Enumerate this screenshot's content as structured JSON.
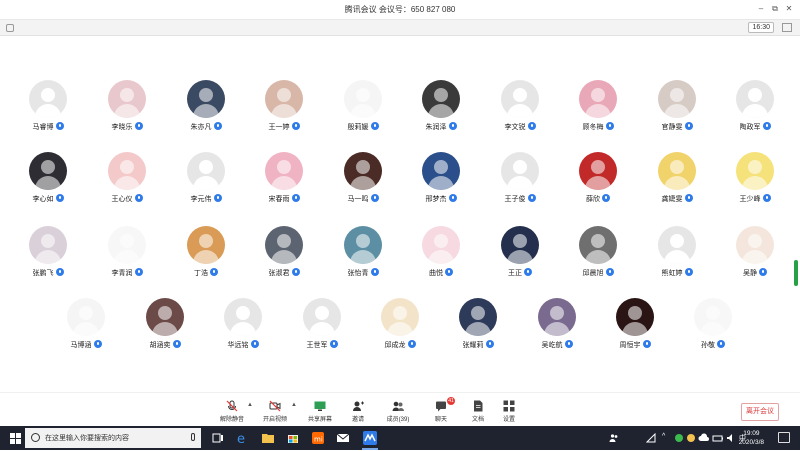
{
  "window": {
    "title": "腾讯会议  会议号：650 827 080",
    "controls": [
      "–",
      "⧉",
      "✕"
    ]
  },
  "subbar": {
    "timer": "16:30"
  },
  "participants": [
    {
      "name": "马睿博",
      "pic": false
    },
    {
      "name": "李晓乐",
      "pic": true,
      "color": "#e8c8cc"
    },
    {
      "name": "朱亦凡",
      "pic": true,
      "color": "#3b4a63"
    },
    {
      "name": "王一婷",
      "pic": true,
      "color": "#d8b7a8"
    },
    {
      "name": "殷莉媛",
      "pic": true,
      "color": "#f5f5f5"
    },
    {
      "name": "朱润泽",
      "pic": true,
      "color": "#3a3a3a"
    },
    {
      "name": "李文锐",
      "pic": false
    },
    {
      "name": "顾冬梅",
      "pic": true,
      "color": "#e9a8b8"
    },
    {
      "name": "官静雯",
      "pic": true,
      "color": "#d7cbc5"
    },
    {
      "name": "陶政军",
      "pic": false
    },
    {
      "name": "李心如",
      "pic": true,
      "color": "#2e2d33"
    },
    {
      "name": "王心仪",
      "pic": true,
      "color": "#f3c9c9"
    },
    {
      "name": "李元伟",
      "pic": false
    },
    {
      "name": "宋春雨",
      "pic": true,
      "color": "#f0b3c4"
    },
    {
      "name": "马一鸣",
      "pic": true,
      "color": "#4a2b25"
    },
    {
      "name": "邢梦杰",
      "pic": true,
      "color": "#2a4f8a"
    },
    {
      "name": "王子俊",
      "pic": false
    },
    {
      "name": "薛欣",
      "pic": true,
      "color": "#c22a2a"
    },
    {
      "name": "龚婕雯",
      "pic": true,
      "color": "#f1d36b"
    },
    {
      "name": "王少峰",
      "pic": true,
      "color": "#f6e27a"
    },
    {
      "name": "张鹏飞",
      "pic": true,
      "color": "#d9d0d9"
    },
    {
      "name": "李青润",
      "pic": true,
      "color": "#f7f7f7"
    },
    {
      "name": "丁浩",
      "pic": true,
      "color": "#d99b55"
    },
    {
      "name": "张淑君",
      "pic": true,
      "color": "#5b6470"
    },
    {
      "name": "张怡青",
      "pic": true,
      "color": "#5c8fa3"
    },
    {
      "name": "曲悦",
      "pic": true,
      "color": "#f6d9e1"
    },
    {
      "name": "王正",
      "pic": true,
      "color": "#232f4d"
    },
    {
      "name": "邱晨旭",
      "pic": true,
      "color": "#6f6f6f"
    },
    {
      "name": "熊虹婷",
      "pic": false
    },
    {
      "name": "吴静",
      "pic": true,
      "color": "#f4e6dc"
    },
    {
      "name": "马博涵",
      "pic": true,
      "color": "#f5f5f5"
    },
    {
      "name": "胡涵奕",
      "pic": true,
      "color": "#6b4a48"
    },
    {
      "name": "华远铭",
      "pic": false
    },
    {
      "name": "王世军",
      "pic": false
    },
    {
      "name": "邱成龙",
      "pic": true,
      "color": "#f3e4c9"
    },
    {
      "name": "张耀莉",
      "pic": true,
      "color": "#2d3a5a"
    },
    {
      "name": "吴屹航",
      "pic": true,
      "color": "#7a6a8f"
    },
    {
      "name": "周恒宇",
      "pic": true,
      "color": "#2a1414"
    },
    {
      "name": "孙敬",
      "pic": true,
      "color": "#f7f7f7"
    }
  ],
  "toolbar": {
    "mute": "解除静音",
    "video": "开启视频",
    "share": "共享屏幕",
    "invite": "邀请",
    "members": "成员(39)",
    "chat": "聊天",
    "chat_badge": "41",
    "docs": "文档",
    "settings": "设置",
    "leave": "离开会议"
  },
  "taskbar": {
    "search_placeholder": "在这里输入你要搜索的内容",
    "time": "19:09",
    "date": "2020/3/8",
    "ime": "中"
  },
  "colors": {
    "accent": "#2f7bea",
    "leave": "#d9383b",
    "taskbar": "#1f2330"
  }
}
